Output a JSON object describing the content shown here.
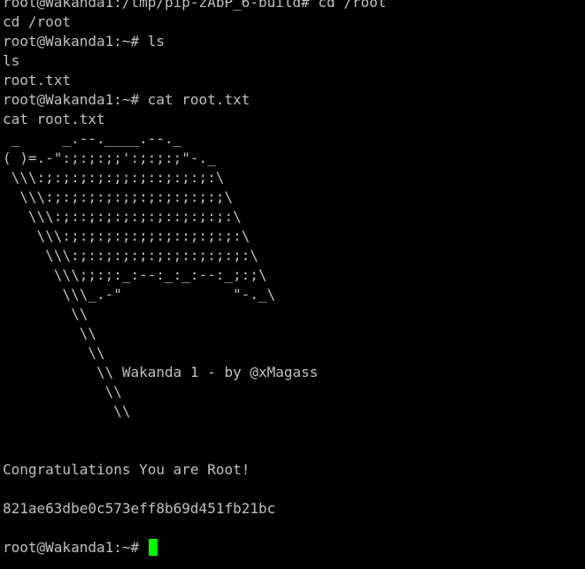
{
  "terminal": {
    "colors": {
      "background": "#000000",
      "text": "#c0c0c0",
      "cursor": "#00ff00"
    },
    "lines": [
      "root@Wakanda1:/tmp/pip-zAbP_6-build# cd /root",
      "cd /root",
      "root@Wakanda1:~# ls",
      "ls",
      "root.txt",
      "root@Wakanda1:~# cat root.txt",
      "cat root.txt",
      " _     _.--.____.--._",
      "( )=.-\":;:;:;;':;:;:;\"-._",
      " \\\\\\:;:;:;:;:;;:;::;:;:;:\\",
      "  \\\\\\:;:;:;:;:;;:;:;:;:;:;\\",
      "   \\\\\\:;::;:;:;:;:;::;:;:;:\\",
      "    \\\\\\:;:;:;:;:;;:;::;:;:;:\\",
      "     \\\\\\:;::;:;:;:;:;::;:;:;:\\",
      "      \\\\\\;;:;:_:--:_:_:--:_;:;\\",
      "       \\\\\\_.-\"             \"-._\\",
      "        \\\\",
      "         \\\\",
      "          \\\\",
      "           \\\\ Wakanda 1 - by @xMagass",
      "            \\\\",
      "             \\\\",
      "",
      "",
      "Congratulations You are Root!",
      "",
      "821ae63dbe0c573eff8b69d451fb21bc",
      ""
    ],
    "prompt": "root@Wakanda1:~# "
  }
}
